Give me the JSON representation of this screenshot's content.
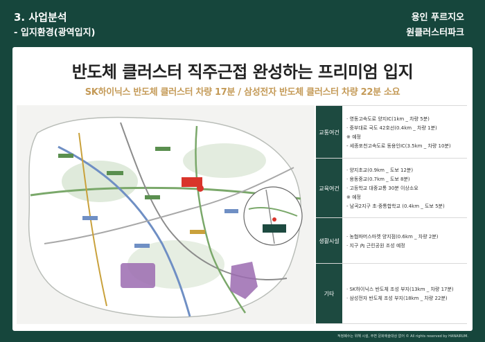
{
  "header": {
    "section_title": "3. 사업분석",
    "section_subtitle": "- 입지환경(광역입지)",
    "brand_line1": "용인 푸르지오",
    "brand_line2": "원클러스터파크"
  },
  "headline": "반도체 클러스터 직주근접 완성하는 프리미엄 입지",
  "subheadline": "SK하이닉스 반도체 클러스터 차량 17분 / 삼성전자 반도체 클러스터 차량 22분 소요",
  "table": {
    "rows": [
      {
        "category": "교통여건",
        "items": [
          "· 영동고속도로 양지IC(1km _ 차량 5분)",
          "· 중부대로 국도 42호선(0.4km _ 차량 1분)",
          "※ 예정",
          "- 세종포천고속도로 동용인IC(3.5km _ 차량 10분)"
        ]
      },
      {
        "category": "교육여건",
        "items": [
          "· 양지초교(0.9km _ 도보 12분)",
          "· 용동중교(0.7km _ 도보 8분)",
          "· 고등학교 대중교통 30분 이상소요",
          "※ 예정",
          "- 남곡2지구 초·중통합학교 (0.4km _ 도보 5분)"
        ]
      },
      {
        "category": "생활시설",
        "items": [
          "· 농협파머스마켓 양지점(0.6km _ 차량 2분)",
          "· 지구 內 근린공원 조성 예정"
        ]
      },
      {
        "category": "기타",
        "items": [
          "· SK하이닉스 반도체 조성 부지(13km _ 차량 17분)",
          "· 삼성전자 반도체 조성 부지(18km _ 차량 22분)"
        ]
      }
    ]
  },
  "footer": {
    "copyright": "적정폐수는 위해 시설, 주변 문화에술대상 없어 © All rights reserved by HANAIRUM."
  },
  "colors": {
    "brand_green": "#16463c",
    "gold": "#c49a57",
    "site_red": "#d9342b",
    "cluster_purple": "#9b6bb0"
  }
}
